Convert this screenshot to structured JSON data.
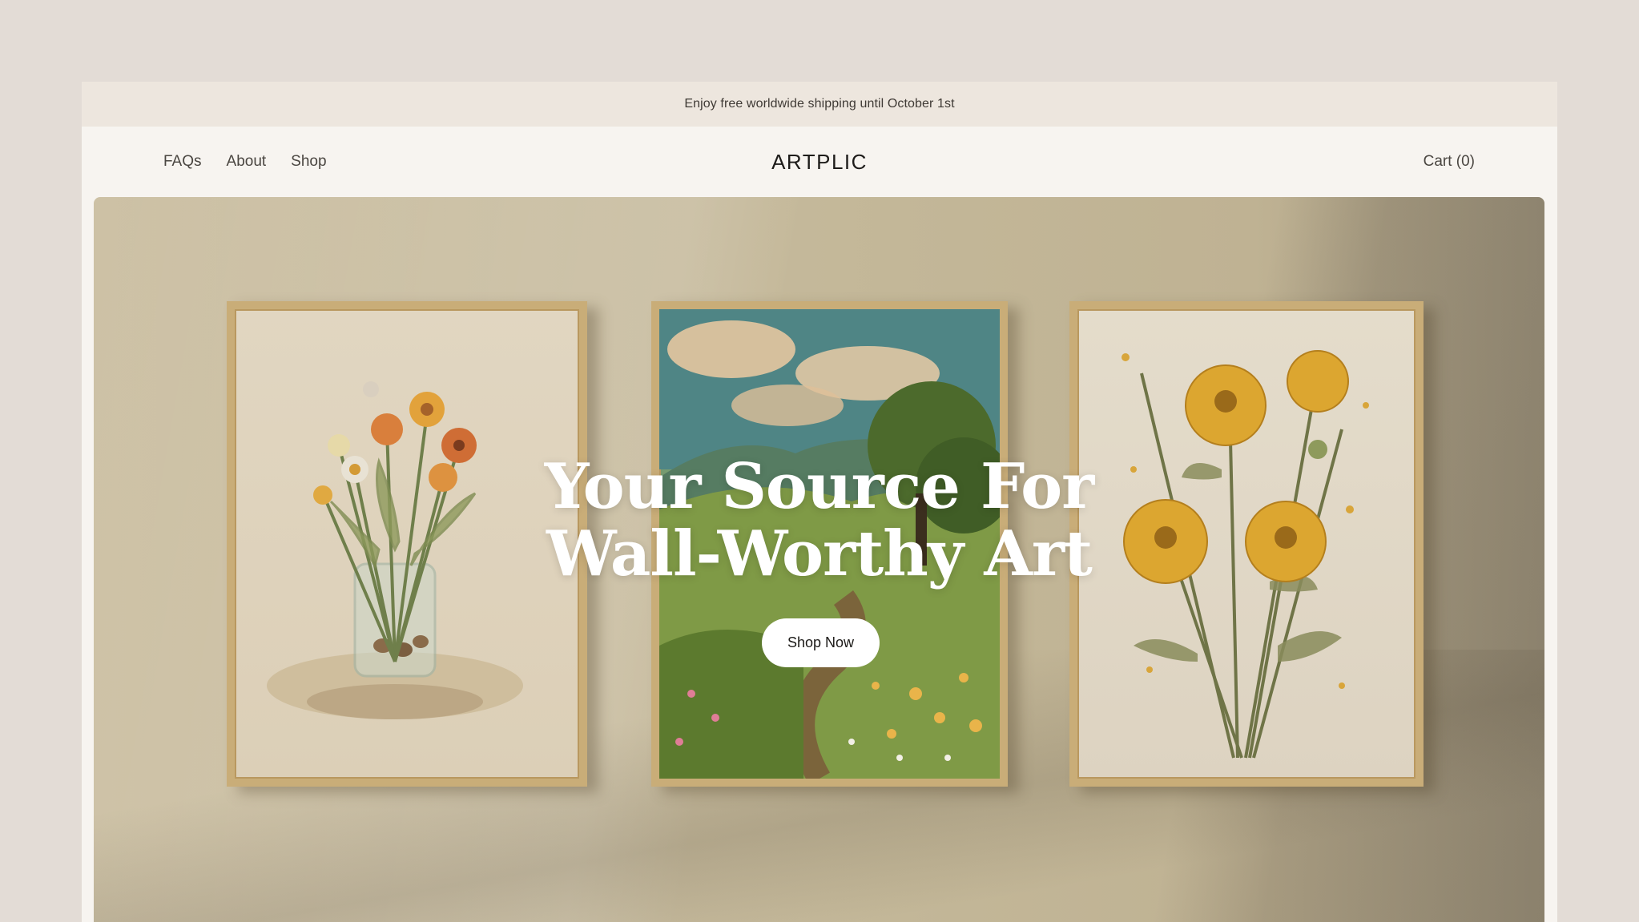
{
  "announcement": {
    "text": "Enjoy free worldwide shipping until October 1st"
  },
  "header": {
    "nav": [
      {
        "label": "FAQs"
      },
      {
        "label": "About"
      },
      {
        "label": "Shop"
      }
    ],
    "logo": "ARTPLIC",
    "cart_label": "Cart (0)"
  },
  "hero": {
    "headline_line1": "Your Source For",
    "headline_line2": "Wall-Worthy Art",
    "cta_label": "Shop Now",
    "artworks": [
      {
        "name": "wildflowers-in-jar-print"
      },
      {
        "name": "countryside-landscape-print"
      },
      {
        "name": "yellow-poppies-print"
      }
    ]
  },
  "colors": {
    "page_bg": "#e3dcd6",
    "announcement_bg": "#ede6de",
    "header_bg": "#f7f4f0",
    "hero_bg": "#c8bc9f",
    "frame_wood": "#c9ad78",
    "cta_bg": "#ffffff"
  }
}
